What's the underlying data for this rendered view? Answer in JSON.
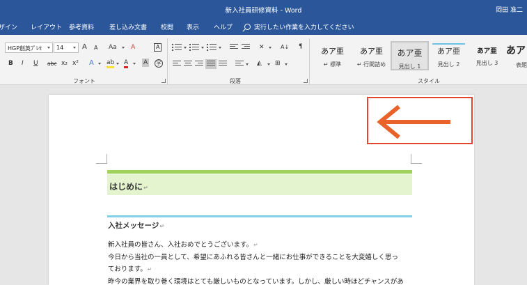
{
  "window": {
    "title": "新入社員研修資料 - Word",
    "user": "岡田 准二"
  },
  "menu": {
    "tabs": [
      "ザイン",
      "レイアウト",
      "参考資料",
      "差し込み文書",
      "校閲",
      "表示",
      "ヘルプ"
    ],
    "tell_me": "実行したい作業を入力してください"
  },
  "ribbon": {
    "font": {
      "name": "HGP創英ﾌﾟﾚｾ",
      "size": "14",
      "grow": "A",
      "shrink": "A",
      "case": "Aa",
      "clear": "A",
      "char_border": "A",
      "bold": "B",
      "italic": "I",
      "underline": "U",
      "strike": "abc",
      "subscript": "x₂",
      "superscript": "x²",
      "effects": "A",
      "highlight": "ab",
      "font_color": "A",
      "shading": "A",
      "enclose": "字",
      "group_label": "フォント"
    },
    "paragraph": {
      "group_label": "段落",
      "sort": "A↓"
    },
    "styles": {
      "group_label": "スタイル",
      "items": [
        {
          "sample": "あア亜",
          "name": "標準"
        },
        {
          "sample": "あア亜",
          "name": "行間詰め"
        },
        {
          "sample": "あア亜",
          "name": "見出し 1"
        },
        {
          "sample": "あア亜",
          "name": "見出し 2"
        },
        {
          "sample": "あア亜",
          "name": "見出し 3"
        },
        {
          "sample": "あア",
          "name": "表題"
        }
      ]
    }
  },
  "document": {
    "heading1": "はじめに",
    "heading2": "入社メッセージ",
    "paragraphs": [
      "新入社員の皆さん、入社おめでとうございます。",
      "今日から当社の一員として、希望にあふれる皆さんと一緒にお仕事ができることを大変嬉しく思っ",
      "ております。",
      "昨今の業界を取り巻く環境はとても厳しいものとなっています。しかし、厳しい時ほどチャンスがあ"
    ]
  },
  "colors": {
    "ribbon_blue": "#2b579a",
    "heading1_bar": "#9ed25a",
    "heading2_line": "#7fd0e8",
    "callout": "#e2442f"
  }
}
